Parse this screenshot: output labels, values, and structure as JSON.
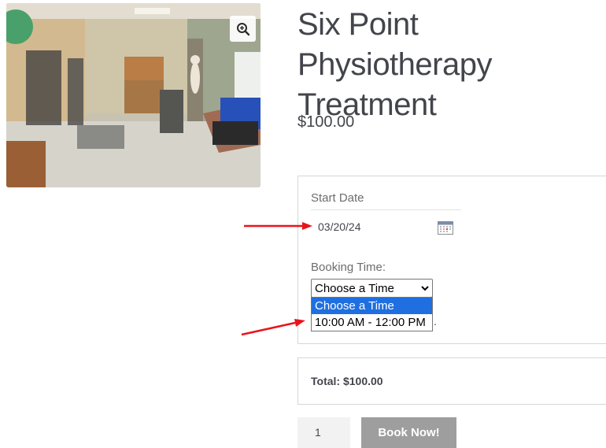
{
  "product": {
    "title": "Six Point Physiotherapy Treatment",
    "price": "$100.00",
    "image_alt": "physiotherapy clinic room"
  },
  "booking": {
    "start_date_label": "Start Date",
    "start_date_value": "03/20/24",
    "time_label": "Booking Time:",
    "time_selected": "Choose a Time",
    "time_options": [
      "Choose a Time",
      "10:00 AM - 12:00 PM"
    ],
    "trailing_text": "."
  },
  "total": {
    "text": "Total: $100.00"
  },
  "cart": {
    "quantity": "1",
    "book_label": "Book Now!"
  },
  "icons": {
    "zoom": "zoom-in-icon",
    "calendar": "calendar-icon",
    "chevron": "chevron-down-icon"
  },
  "colors": {
    "accent": "#1f6fe0",
    "button": "#9e9e9e",
    "annotation": "#e8141c"
  }
}
